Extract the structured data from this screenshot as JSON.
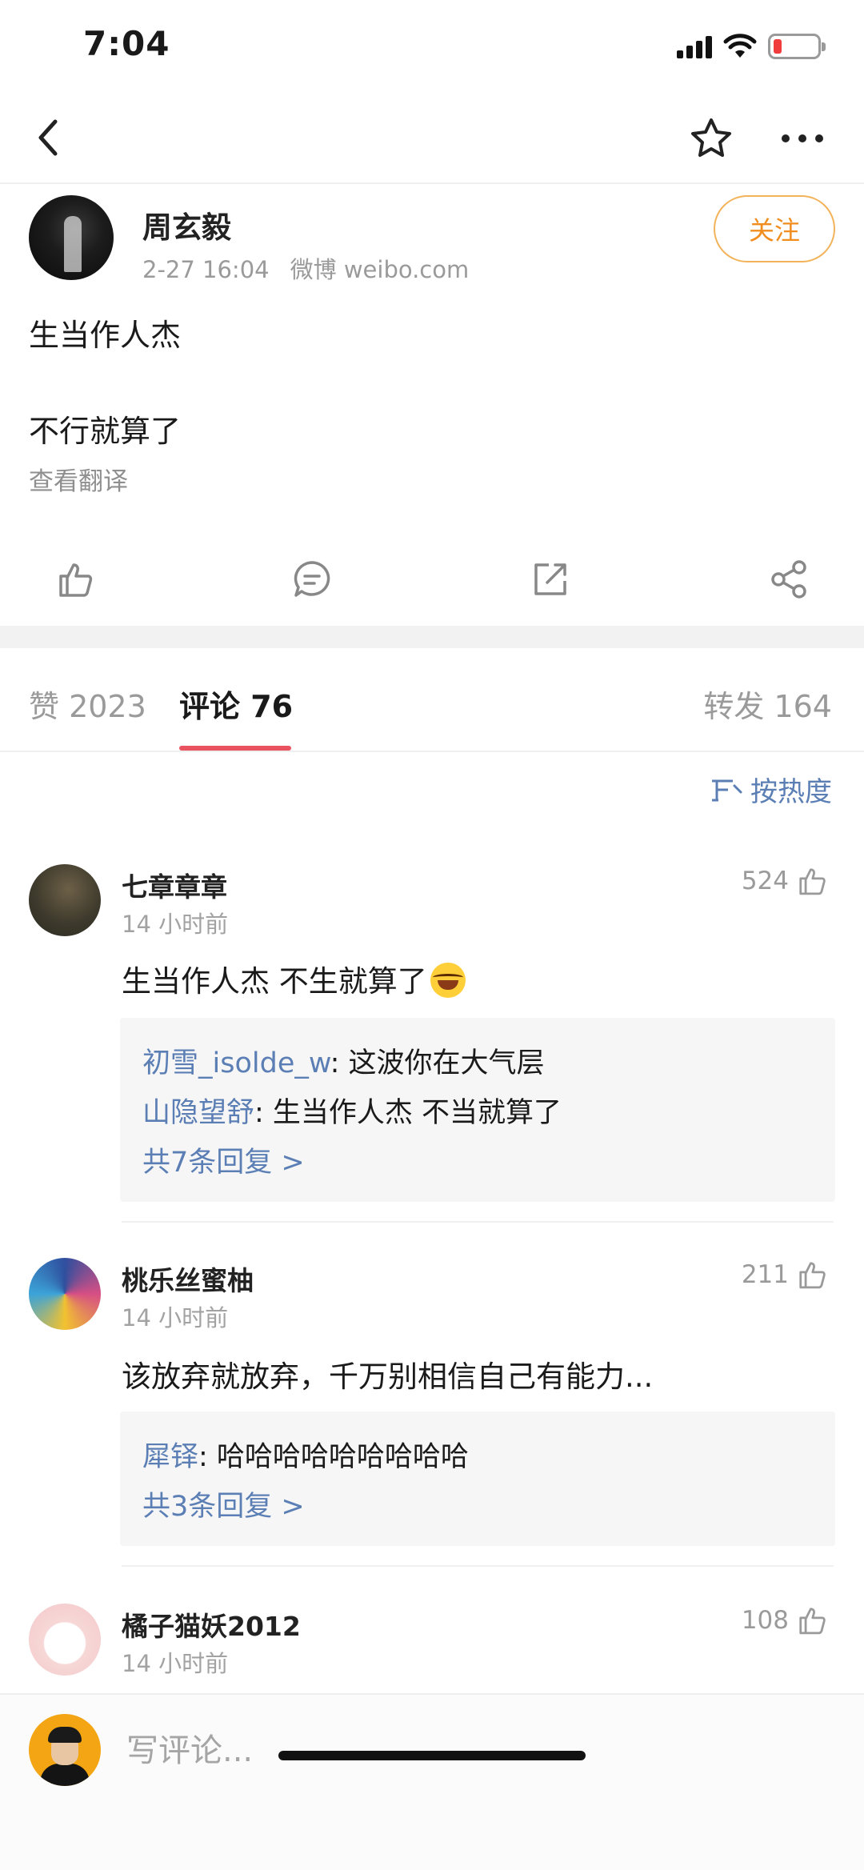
{
  "status": {
    "time": "7:04"
  },
  "post": {
    "author": "周玄毅",
    "date": "2-27 16:04",
    "source": "微博 weibo.com",
    "follow_label": "关注",
    "line1": "生当作人杰",
    "line2": "不行就算了",
    "translate_label": "查看翻译"
  },
  "tabs": {
    "likes": "赞 2023",
    "comments": "评论 76",
    "reposts": "转发 164"
  },
  "sort_label": "按热度",
  "comments": [
    {
      "name": "七章章章",
      "time": "14 小时前",
      "likes": "524",
      "text": "生当作人杰 不生就算了",
      "emoji": "laugh-cry",
      "replies": [
        {
          "user": "初雪_isolde_w",
          "text": ": 这波你在大气层"
        },
        {
          "user": "山隐望舒",
          "text": ": 生当作人杰 不当就算了"
        }
      ],
      "more": "共7条回复 >"
    },
    {
      "name": "桃乐丝蜜柚",
      "time": "14 小时前",
      "likes": "211",
      "text": "该放弃就放弃，千万别相信自己有能力...",
      "replies": [
        {
          "user": "犀铎",
          "text": ": 哈哈哈哈哈哈哈哈哈"
        }
      ],
      "more": "共3条回复 >"
    },
    {
      "name": "橘子猫妖2012",
      "time": "14 小时前",
      "likes": "108"
    }
  ],
  "input": {
    "placeholder": "写评论..."
  },
  "colors": {
    "accent_orange": "#f08d1e",
    "tab_indicator": "#e8535f",
    "link_blue": "#5b7fb5"
  }
}
